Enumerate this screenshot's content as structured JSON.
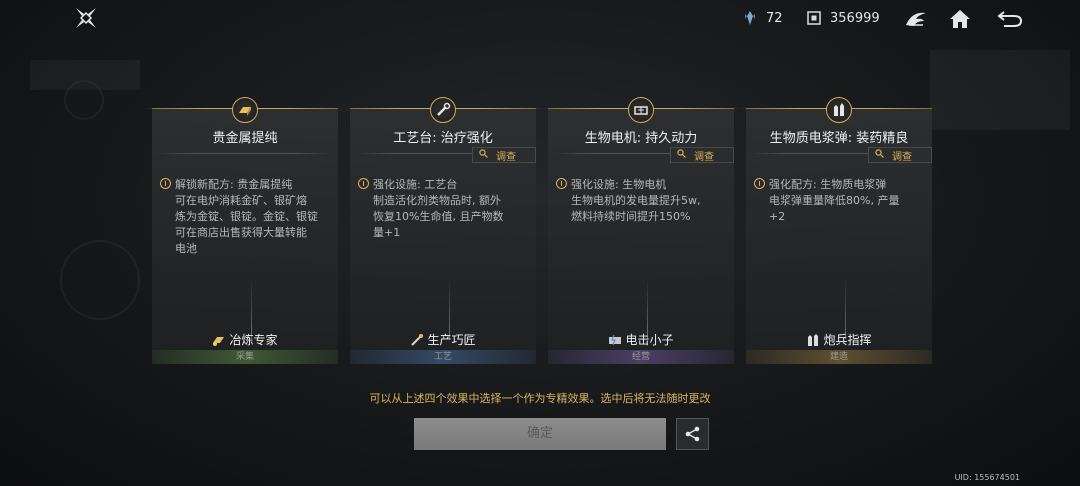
{
  "topbar": {
    "resource1_icon": "crystal-icon",
    "resource1_value": "72",
    "resource2_icon": "chip-icon",
    "resource2_value": "356999",
    "nav_icons": [
      "faction-emblem-icon",
      "home-icon",
      "back-arrow-icon"
    ]
  },
  "cards": [
    {
      "icon": "gold-bar-icon",
      "title": "贵金属提纯",
      "investigate": "",
      "body": [
        "解锁新配方: 贵金属提纯",
        "可在电炉消耗金矿、银矿熔",
        "炼为金锭、银锭。金锭、银锭",
        "可在商店出售获得大量转能",
        "电池"
      ],
      "bonus": "冶炼专家",
      "category": "采集",
      "category_color": "#3f5a34"
    },
    {
      "icon": "wrench-icon",
      "title": "工艺台: 治疗强化",
      "investigate": "调查",
      "body": [
        "强化设施: 工艺台",
        "制造活化剂类物品时, 额外",
        "恢复10%生命值, 且产物数",
        "量+1"
      ],
      "bonus": "生产巧匠",
      "category": "工艺",
      "category_color": "#344a66"
    },
    {
      "icon": "generator-icon",
      "title": "生物电机: 持久动力",
      "investigate": "调查",
      "body": [
        "强化设施: 生物电机",
        "生物电机的发电量提升5w,",
        "燃料持续时间提升150%"
      ],
      "bonus": "电击小子",
      "category": "经营",
      "category_color": "#4a3f66"
    },
    {
      "icon": "ammo-icon",
      "title": "生物质电浆弹: 装药精良",
      "investigate": "调查",
      "body": [
        "强化配方: 生物质电浆弹",
        "电浆弹重量降低80%, 产量",
        "+2"
      ],
      "bonus": "炮兵指挥",
      "category": "建造",
      "category_color": "#5e5030"
    }
  ],
  "hint": "可以从上述四个效果中选择一个作为专精效果。选中后将无法随时更改",
  "confirm_label": "确定",
  "share_icon": "share-icon",
  "uid": "UID: 155674501",
  "colors": {
    "accent_gold": "#d9b45f",
    "title_gold": "#c9a95a"
  }
}
